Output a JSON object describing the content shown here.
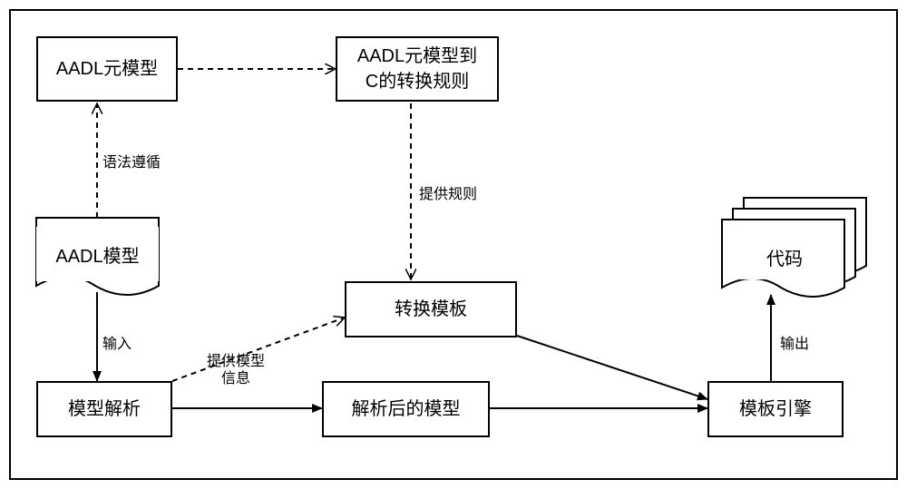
{
  "nodes": {
    "aadl_meta": "AADL元模型",
    "rules": "AADL元模型到\nC的转换规则",
    "aadl_model": "AADL模型",
    "parse": "模型解析",
    "template": "转换模板",
    "parsed_model": "解析后的模型",
    "engine": "模板引擎",
    "code": "代码"
  },
  "edges": {
    "syntax_follow": "语法遵循",
    "provide_rules": "提供规则",
    "input": "输入",
    "provide_model_info": "提供模型\n信息",
    "output": "输出"
  }
}
